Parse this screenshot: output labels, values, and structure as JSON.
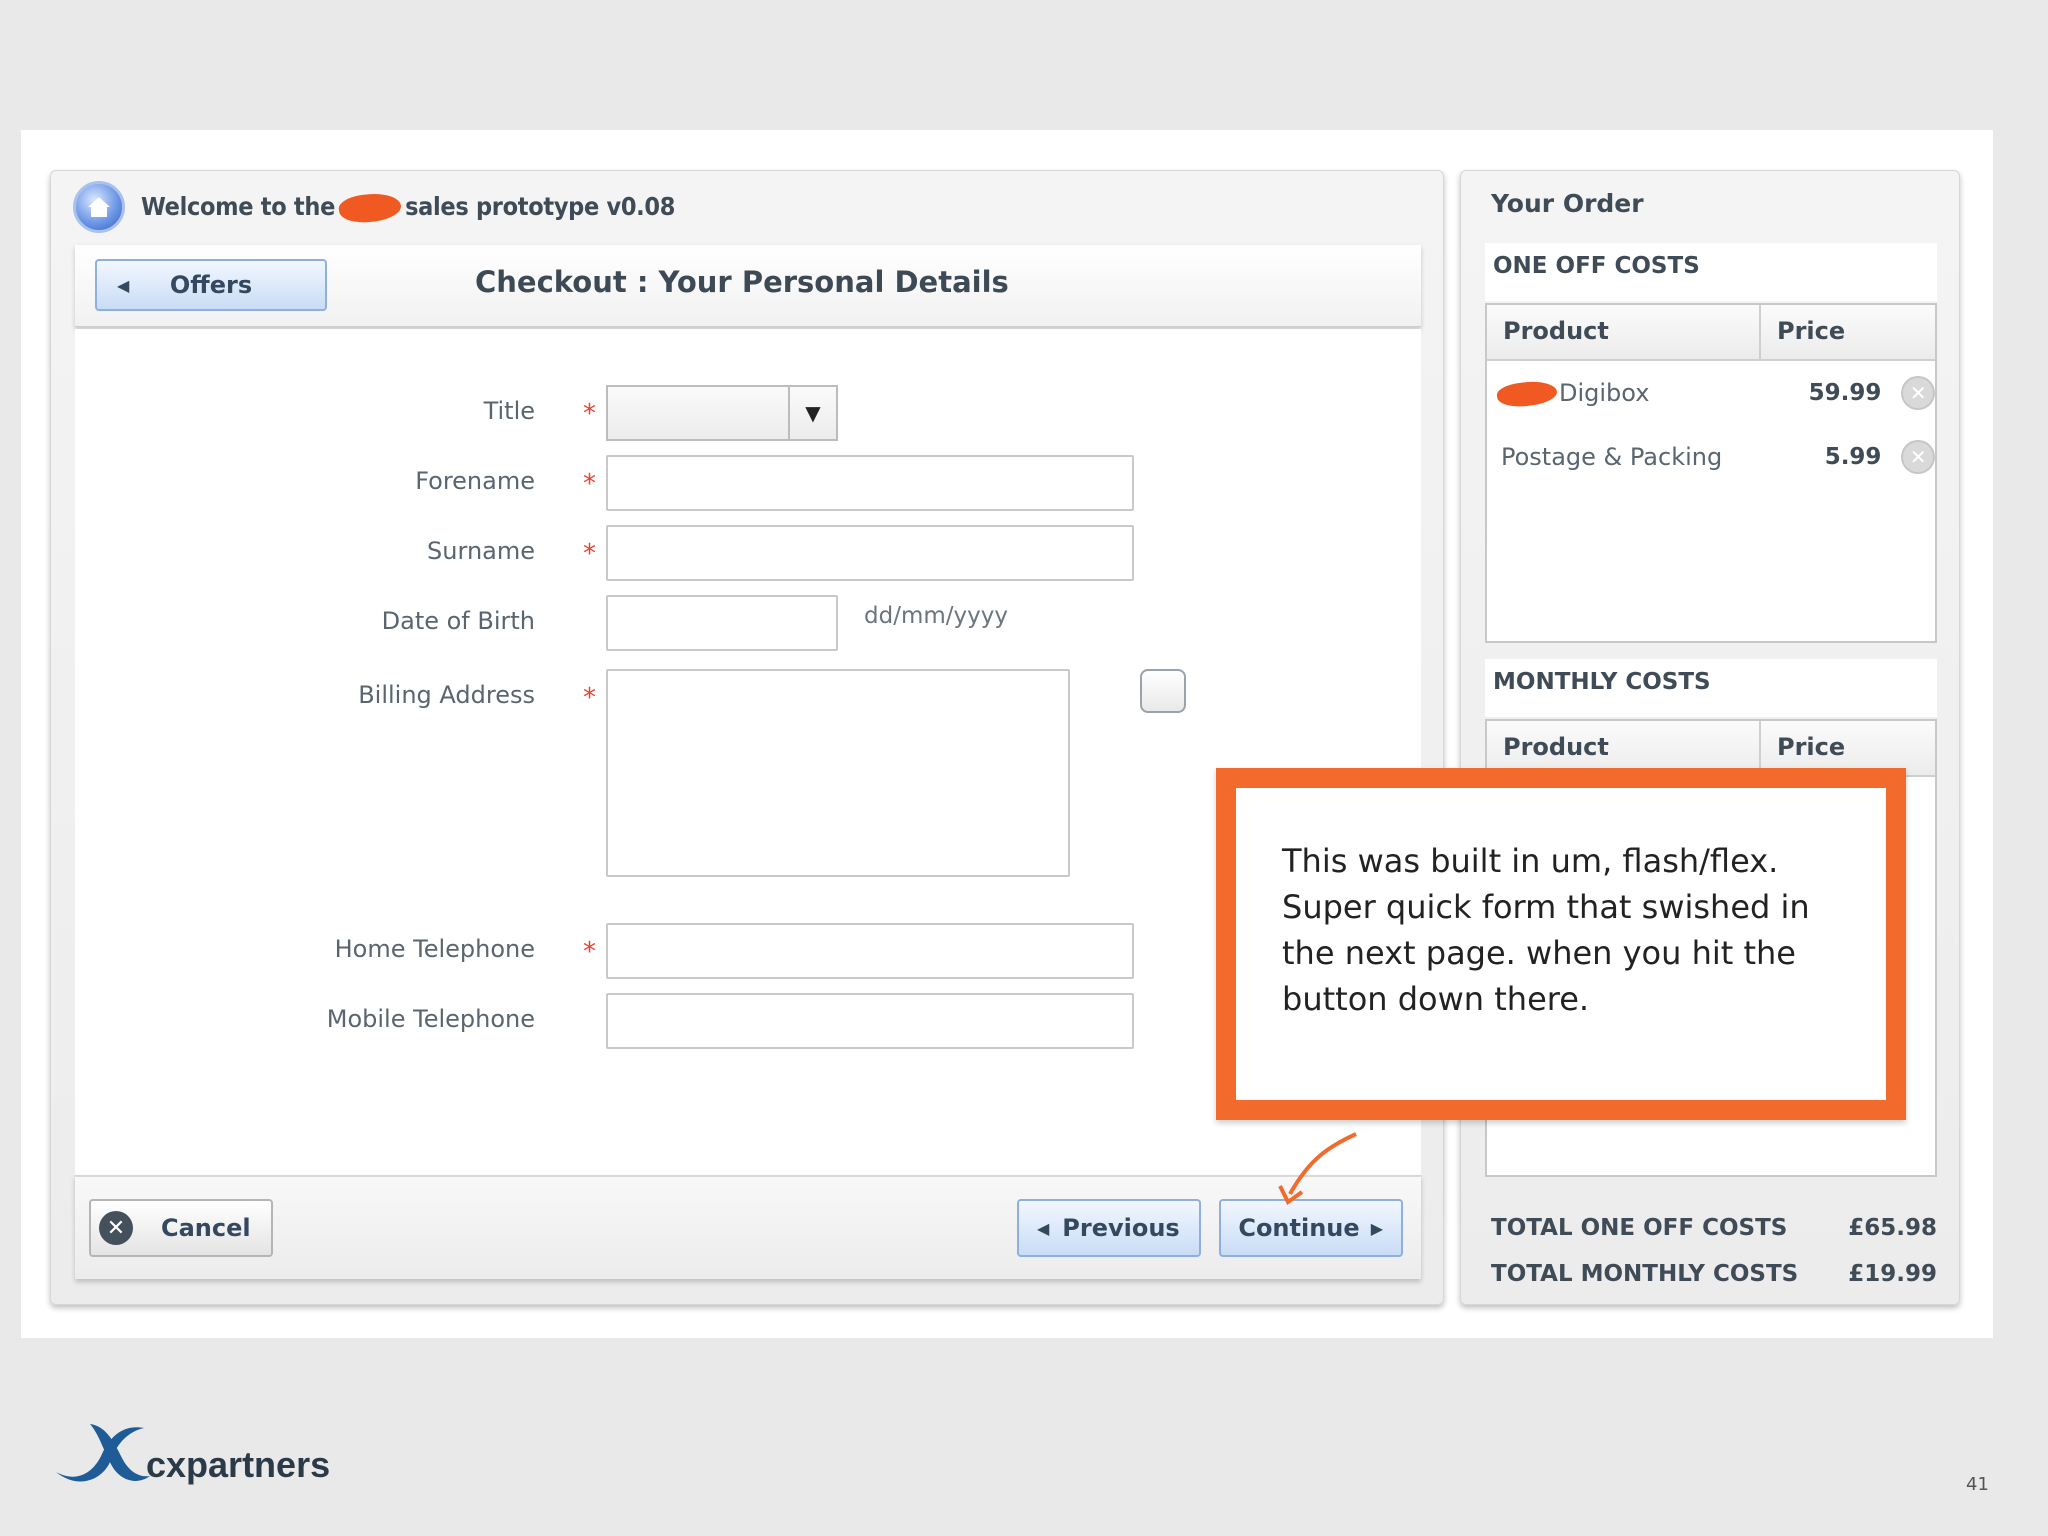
{
  "app": {
    "title_prefix": "Welcome to the",
    "title_suffix": "sales prototype v0.08"
  },
  "toolbar": {
    "back_label": "Offers",
    "page_title": "Checkout : Your Personal Details"
  },
  "form": {
    "title_label": "Title",
    "forename_label": "Forename",
    "surname_label": "Surname",
    "dob_label": "Date of Birth",
    "dob_hint": "dd/mm/yyyy",
    "billing_label": "Billing Address",
    "home_tel_label": "Home Telephone",
    "mobile_tel_label": "Mobile Telephone",
    "required_marker": "*"
  },
  "footer": {
    "cancel_label": "Cancel",
    "previous_label": "Previous",
    "continue_label": "Continue"
  },
  "order": {
    "title": "Your Order",
    "one_off_label": "ONE OFF COSTS",
    "monthly_label": "MONTHLY COSTS",
    "col_product": "Product",
    "col_price": "Price",
    "one_off_items": [
      {
        "product": "Digibox",
        "price": "59.99"
      },
      {
        "product": "Postage & Packing",
        "price": "5.99"
      }
    ],
    "total_one_off_label": "TOTAL ONE OFF COSTS",
    "total_one_off_value": "£65.98",
    "total_monthly_label": "TOTAL MONTHLY COSTS",
    "total_monthly_value": "£19.99"
  },
  "annotation": {
    "text": "This was built in um, flash/flex. Super quick form that swished in the next page. when you hit the button down there."
  },
  "brand": {
    "name": "cxpartners",
    "page_number": "41"
  },
  "colors": {
    "accent_orange": "#f26a2c",
    "redaction": "#f05a22",
    "button_blue": "#c9dcf5",
    "required_red": "#e8432d"
  }
}
